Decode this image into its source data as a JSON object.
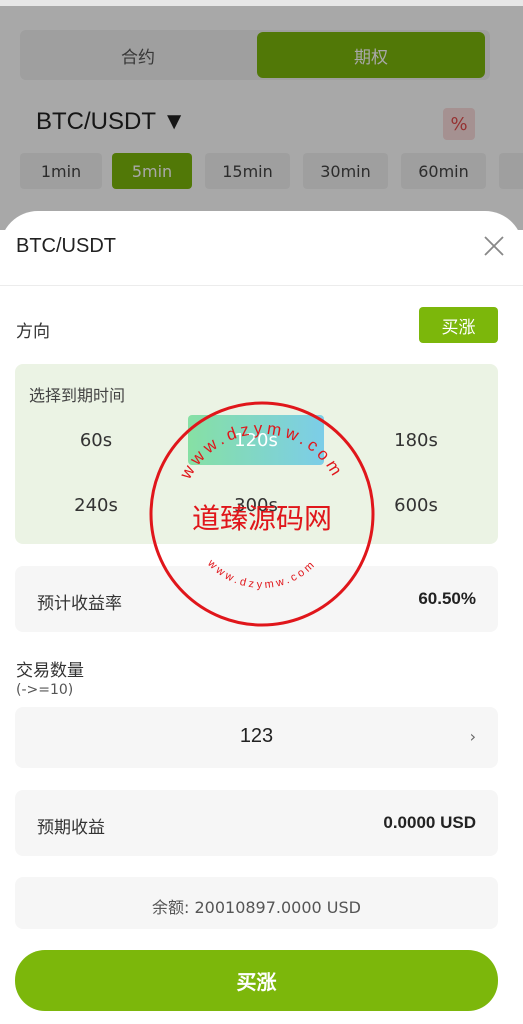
{
  "background": {
    "segments": [
      "合约",
      "期权"
    ],
    "pair": "BTC/USDT ▼",
    "percent_icon": "%",
    "timeframes": [
      "1min",
      "5min",
      "15min",
      "30min",
      "60min"
    ],
    "active_timeframe": "5min"
  },
  "sheet": {
    "title": "BTC/USDT",
    "direction_label": "方向",
    "direction_button": "买涨",
    "expiry_title": "选择到期时间",
    "expiry_options": [
      "60s",
      "120s",
      "180s",
      "240s",
      "300s",
      "600s"
    ],
    "selected_expiry": "120s",
    "yield_label": "预计收益率",
    "yield_value": "60.50%",
    "quantity_label": "交易数量",
    "quantity_hint": "(->=10)",
    "quantity_value": "123",
    "quantity_arrow": "›",
    "expected_label": "预期收益",
    "expected_value": "0.0000 USD",
    "balance": "余额: 20010897.0000 USD",
    "buy_button": "买涨"
  },
  "watermark": {
    "main_text": "道臻源码网",
    "ring_top": "www.dzymw.com",
    "ring_bottom": "www.dzymw.com"
  },
  "colors": {
    "accent": "#7cb70b",
    "stamp": "#e0161b"
  }
}
